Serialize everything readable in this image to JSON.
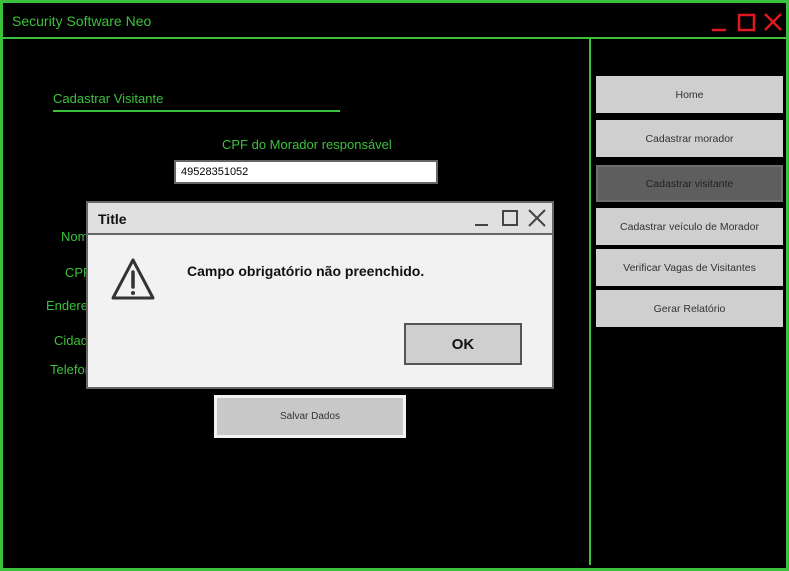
{
  "app": {
    "title": "Security Software Neo"
  },
  "form": {
    "section_title": "Cadastrar Visitante",
    "cpf_label": "CPF do Morador responsável",
    "cpf_value": "49528351052",
    "fields": [
      "Nom",
      "CPF",
      "Endere",
      "Cidad",
      "Telefon"
    ],
    "save_label": "Salvar Dados"
  },
  "sidebar": {
    "items": [
      {
        "label": "Home",
        "active": false
      },
      {
        "label": "Cadastrar morador",
        "active": false
      },
      {
        "label": "Cadastrar visitante",
        "active": true
      },
      {
        "label": "Cadastrar veículo de Morador",
        "active": false
      },
      {
        "label": "Verificar Vagas de Visitantes",
        "active": false
      },
      {
        "label": "Gerar Relatório",
        "active": false
      }
    ]
  },
  "dialog": {
    "title": "Title",
    "message": "Campo obrigatório não preenchido.",
    "ok_label": "OK",
    "icon": "warning-icon"
  },
  "colors": {
    "accent": "#3cc13c",
    "close_red": "#e0191f",
    "background": "#000000",
    "button_gray": "#cfcfcf",
    "active_gray": "#5e5e5e"
  }
}
